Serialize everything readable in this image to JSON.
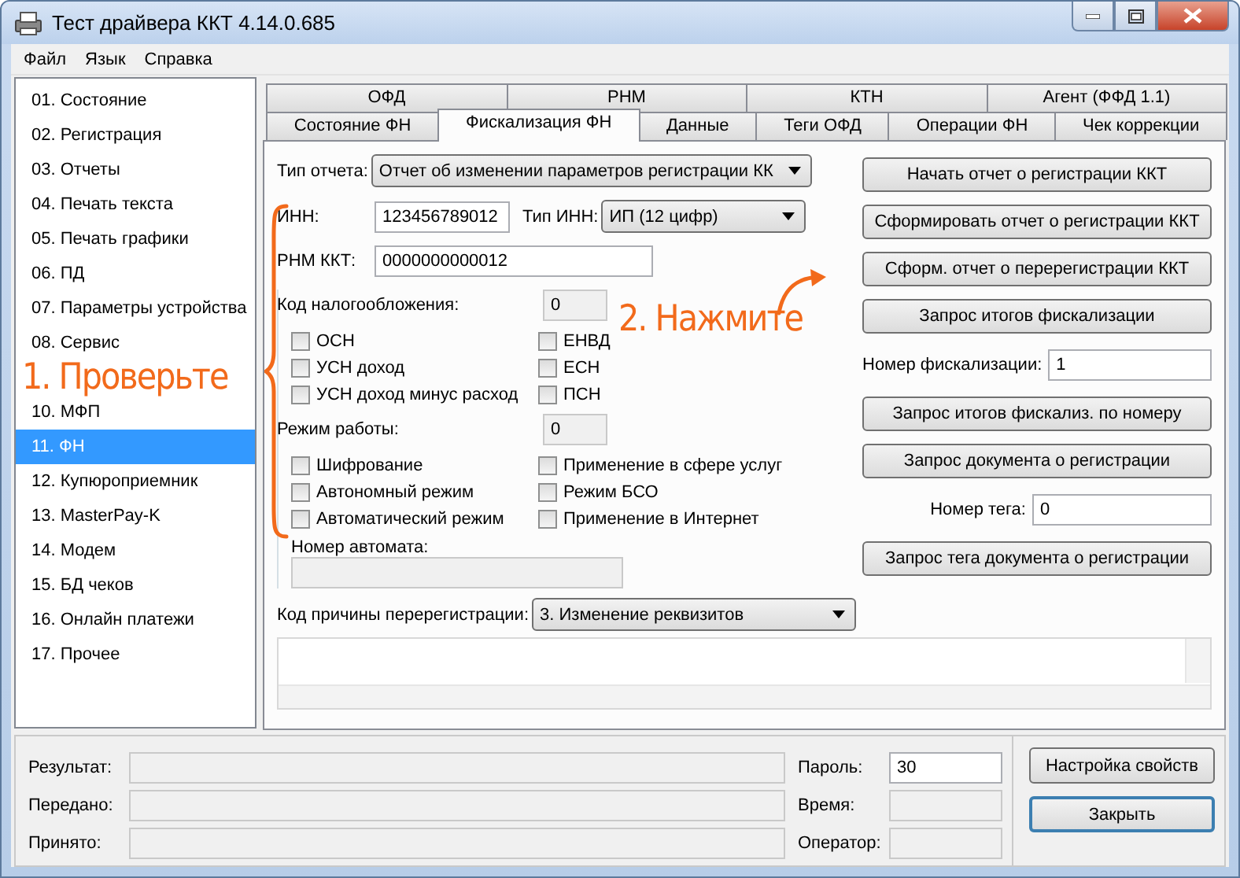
{
  "window": {
    "title": "Тест драйвера ККТ 4.14.0.685"
  },
  "menu": [
    "Файл",
    "Язык",
    "Справка"
  ],
  "sidebar": {
    "items": [
      {
        "kind": "item",
        "label": "01. Состояние",
        "selected": false
      },
      {
        "kind": "item",
        "label": "02. Регистрация",
        "selected": false
      },
      {
        "kind": "item",
        "label": "03. Отчеты",
        "selected": false
      },
      {
        "kind": "item",
        "label": "04. Печать текста",
        "selected": false
      },
      {
        "kind": "item",
        "label": "05. Печать графики",
        "selected": false
      },
      {
        "kind": "item",
        "label": "06. ПД",
        "selected": false
      },
      {
        "kind": "item",
        "label": "07. Параметры устройства",
        "selected": false
      },
      {
        "kind": "item",
        "label": "08. Сервис",
        "selected": false
      },
      {
        "kind": "callout",
        "label": "1. Проверьте"
      },
      {
        "kind": "item",
        "label": "10. МФП",
        "selected": false
      },
      {
        "kind": "item",
        "label": "11. ФН",
        "selected": true
      },
      {
        "kind": "item",
        "label": "12. Купюроприемник",
        "selected": false
      },
      {
        "kind": "item",
        "label": "13. MasterPay-K",
        "selected": false
      },
      {
        "kind": "item",
        "label": "14. Модем",
        "selected": false
      },
      {
        "kind": "item",
        "label": "15. БД чеков",
        "selected": false
      },
      {
        "kind": "item",
        "label": "16. Онлайн платежи",
        "selected": false
      },
      {
        "kind": "item",
        "label": "17. Прочее",
        "selected": false
      }
    ]
  },
  "tabs": [
    [
      {
        "label": "ОФД",
        "selected": false
      },
      {
        "label": "РНМ",
        "selected": false
      },
      {
        "label": "КТН",
        "selected": false
      },
      {
        "label": "Агент (ФФД 1.1)",
        "selected": false
      }
    ],
    [
      {
        "label": "Состояние ФН",
        "selected": false
      },
      {
        "label": "Фискализация ФН",
        "selected": true
      },
      {
        "label": "Данные",
        "selected": false
      },
      {
        "label": "Теги ОФД",
        "selected": false
      },
      {
        "label": "Операции ФН",
        "selected": false
      },
      {
        "label": "Чек коррекции",
        "selected": false
      }
    ]
  ],
  "form": {
    "report_type": {
      "label": "Тип отчета:",
      "value": "Отчет об изменении параметров регистрации КК"
    },
    "inn": {
      "label": "ИНН:",
      "value": "123456789012"
    },
    "inn_type": {
      "label": "Тип ИНН:",
      "value": "ИП (12 цифр)"
    },
    "rnm": {
      "label": "РНМ ККТ:",
      "value": "0000000000012"
    },
    "tax_code": {
      "label": "Код налогообложения:",
      "value": "0"
    },
    "tax_systems": [
      {
        "label": "ОСН",
        "checked": false
      },
      {
        "label": "УСН доход",
        "checked": false
      },
      {
        "label": "УСН доход минус расход",
        "checked": false
      },
      {
        "label": "ЕНВД",
        "checked": false
      },
      {
        "label": "ЕСН",
        "checked": false
      },
      {
        "label": "ПСН",
        "checked": false
      }
    ],
    "work_mode": {
      "label": "Режим работы:",
      "value": "0"
    },
    "work_modes": [
      {
        "label": "Шифрование",
        "checked": false
      },
      {
        "label": "Автономный режим",
        "checked": false
      },
      {
        "label": "Автоматический режим",
        "checked": false
      },
      {
        "label": "Применение в сфере услуг",
        "checked": false
      },
      {
        "label": "Режим БСО",
        "checked": false
      },
      {
        "label": "Применение в Интернет",
        "checked": false
      }
    ],
    "machine_number": {
      "label": "Номер автомата:",
      "disabled": true
    }
  },
  "actions": [
    {
      "kind": "button",
      "label": "Начать отчет о регистрации ККТ"
    },
    {
      "kind": "button",
      "label": "Сформировать отчет о регистрации ККТ"
    },
    {
      "kind": "button",
      "label": "Сформ. отчет о перерегистрации ККТ"
    },
    {
      "kind": "button",
      "label": "Запрос итогов фискализации"
    },
    {
      "kind": "field",
      "label": "Номер фискализации:",
      "value": "1"
    },
    {
      "kind": "button",
      "label": "Запрос итогов фискализ. по номеру"
    },
    {
      "kind": "button",
      "label": "Запрос документа о регистрации"
    },
    {
      "kind": "field",
      "label": "Номер тега:",
      "value": "0"
    },
    {
      "kind": "button",
      "label": "Запрос тега документа о регистрации"
    }
  ],
  "reason": {
    "label": "Код причины перерегистрации:",
    "value": "3. Изменение реквизитов"
  },
  "callout": {
    "text": "2. Нажмите"
  },
  "status": {
    "left": [
      {
        "label": "Результат:"
      },
      {
        "label": "Передано:"
      },
      {
        "label": "Принято:"
      }
    ],
    "right": [
      {
        "label": "Пароль:",
        "value": "30",
        "disabled": false
      },
      {
        "label": "Время:",
        "disabled": true
      },
      {
        "label": "Оператор:",
        "disabled": true
      }
    ]
  },
  "buttons": [
    {
      "label": "Настройка свойств",
      "default": false
    },
    {
      "label": "Закрыть",
      "default": true
    }
  ]
}
